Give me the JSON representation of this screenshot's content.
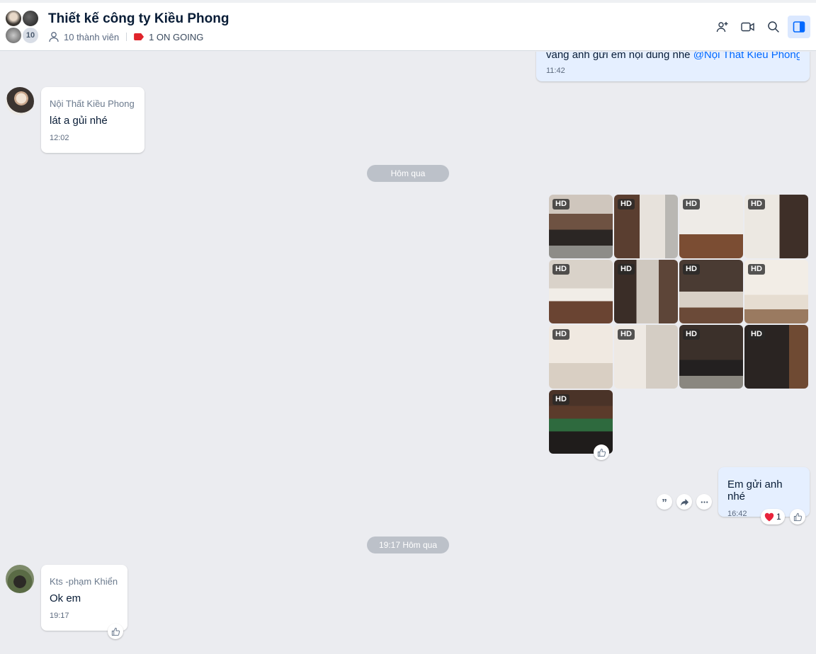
{
  "header": {
    "title": "Thiết kế công ty Kiều Phong",
    "member_count_badge": "10",
    "members_label": "10 thành viên",
    "tag_label": "1 ON GOING",
    "icons": [
      "add-member-icon",
      "video-call-icon",
      "search-icon",
      "toggle-sidebar-icon"
    ]
  },
  "messages": {
    "m0": {
      "text": "vâng anh gửi em nội dung nhé ",
      "mention": "@Nội Thất Kiều Phong",
      "time": "11:42"
    },
    "m1": {
      "sender": "Nội Thất Kiều Phong",
      "text": "lát a gủi nhé",
      "time": "12:02"
    },
    "divider1": "Hôm qua",
    "gallery": {
      "badge": "HD",
      "count": 13
    },
    "m2": {
      "text": "Em gửi anh nhé",
      "time": "16:42",
      "reaction_count": "1"
    },
    "divider2": "19:17 Hôm qua",
    "m3": {
      "sender": "Kts -phạm Khiển",
      "text": "Ok em",
      "time": "19:17"
    }
  },
  "colors": {
    "accent": "#0068ff",
    "tag": "#e0242b",
    "outgoing_bubble": "#e5efff",
    "chat_bg": "#ebecf0"
  }
}
